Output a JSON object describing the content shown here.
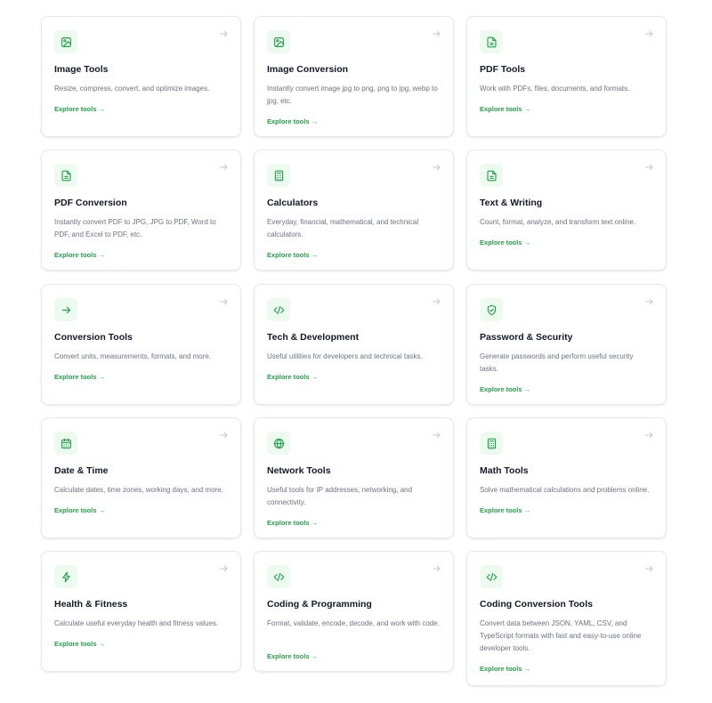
{
  "cards": [
    {
      "title": "Image Tools",
      "desc": "Resize, compress, convert, and optimize images.",
      "cta": "Explore tools →",
      "icon": "image-icon"
    },
    {
      "title": "Image Conversion",
      "desc": "Instantly convert image jpg to png, png to jpg, webp to jpg, etc.",
      "cta": "Explore tools →",
      "icon": "image-icon"
    },
    {
      "title": "PDF Tools",
      "desc": "Work with PDFs, files, documents, and formats.",
      "cta": "Explore tools →",
      "icon": "document-icon"
    },
    {
      "title": "PDF Conversion",
      "desc": "Instantly convert PDF to JPG, JPG to PDF, Word to PDF, and Excel to PDF, etc.",
      "cta": "Explore tools →",
      "icon": "document-icon"
    },
    {
      "title": "Calculators",
      "desc": "Everyday, financial, mathematical, and technical calculators.",
      "cta": "Explore tools →",
      "icon": "calculator-icon"
    },
    {
      "title": "Text & Writing",
      "desc": "Count, format, analyze, and transform text online.",
      "cta": "Explore tools →",
      "icon": "document-icon"
    },
    {
      "title": "Conversion Tools",
      "desc": "Convert units, measurements, formats, and more.",
      "cta": "Explore tools →",
      "icon": "arrow-right-icon"
    },
    {
      "title": "Tech & Development",
      "desc": "Useful utilities for developers and technical tasks.",
      "cta": "Explore tools →",
      "icon": "code-icon"
    },
    {
      "title": "Password & Security",
      "desc": "Generate passwords and perform useful security tasks.",
      "cta": "Explore tools →",
      "icon": "shield-icon"
    },
    {
      "title": "Date & Time",
      "desc": "Calculate dates, time zones, working days, and more.",
      "cta": "Explore tools →",
      "icon": "calendar-icon"
    },
    {
      "title": "Network Tools",
      "desc": "Useful tools for IP addresses, networking, and connectivity.",
      "cta": "Explore tools →",
      "icon": "globe-icon"
    },
    {
      "title": "Math Tools",
      "desc": "Solve mathematical calculations and problems online.",
      "cta": "Explore tools →",
      "icon": "calculator-icon"
    },
    {
      "title": "Health & Fitness",
      "desc": "Calculate useful everyday health and fitness values.",
      "cta": "Explore tools →",
      "icon": "lightning-icon"
    },
    {
      "title": "Coding & Programming",
      "desc": "Format, validate, encode, decode, and work with code.",
      "cta": "Explore tools →",
      "icon": "code-icon"
    },
    {
      "title": "Coding Conversion Tools",
      "desc": "Convert data between JSON, YAML, CSV, and TypeScript formats with fast and easy-to-use online developer tools.",
      "cta": "Explore tools →",
      "icon": "code-icon"
    }
  ],
  "colors": {
    "accent": "#22a049",
    "icon_bg": "#ecfaf0",
    "title": "#111827",
    "desc": "#6b7280",
    "border": "#e6e8ec"
  }
}
